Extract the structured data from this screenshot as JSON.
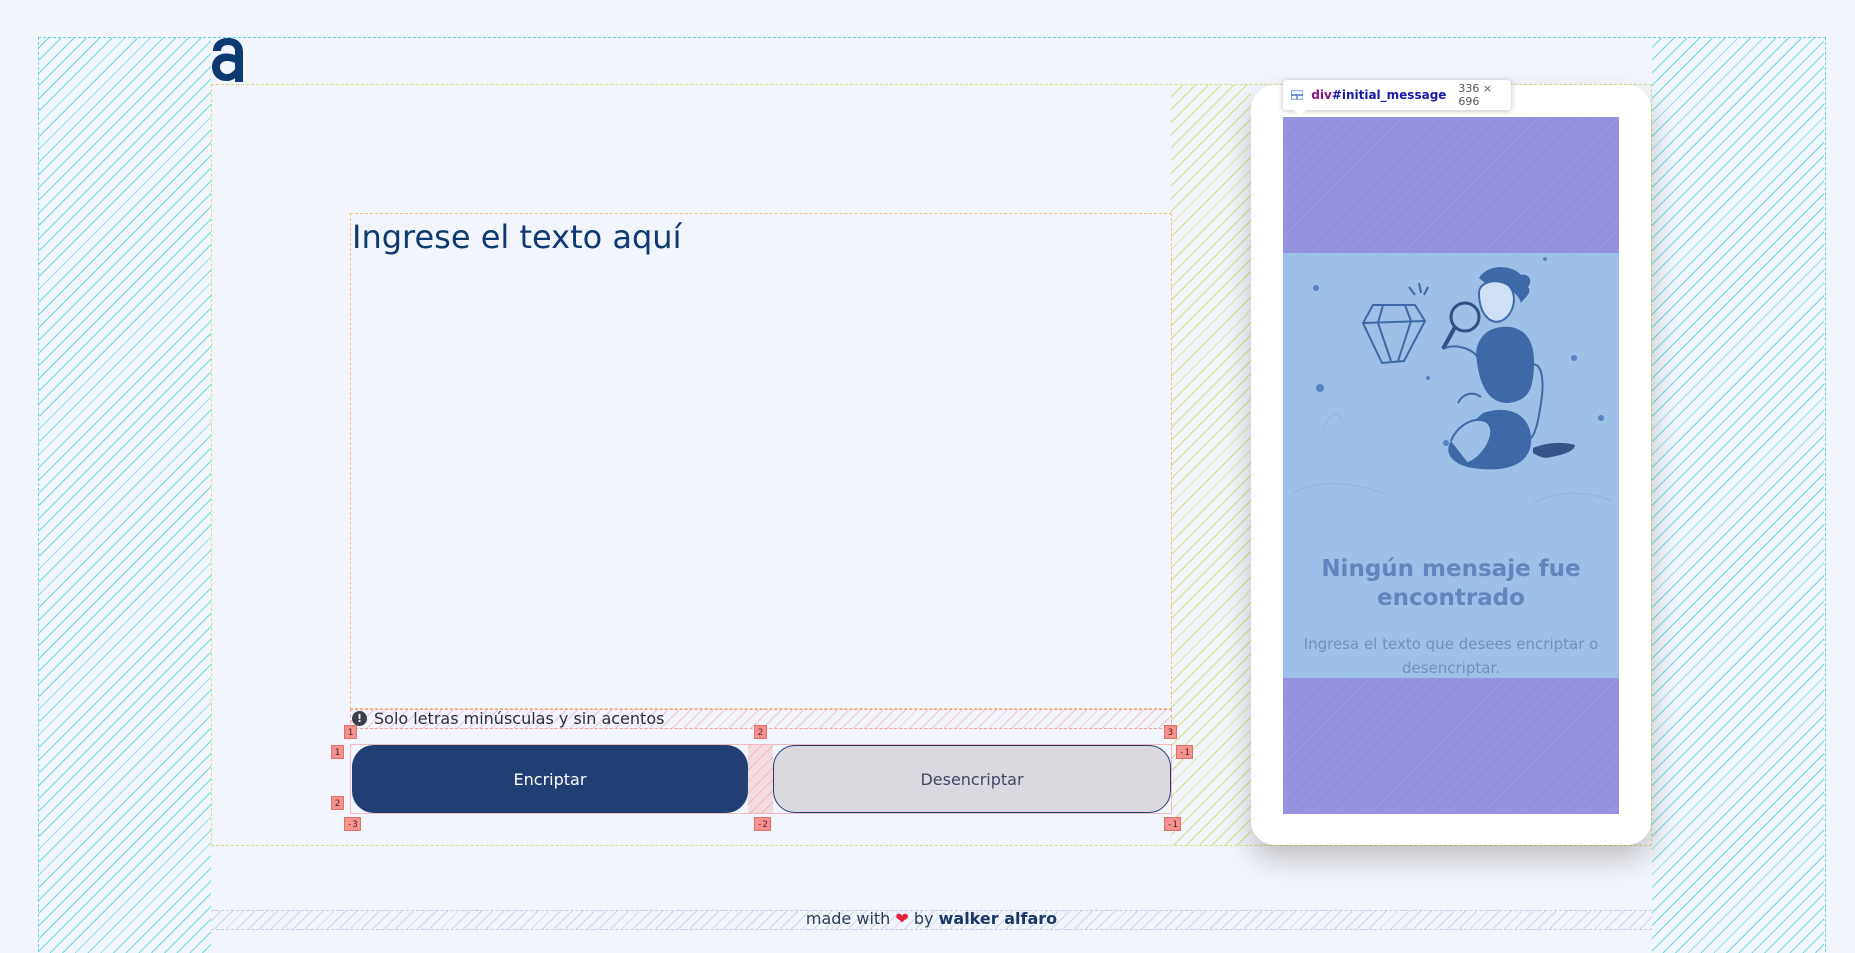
{
  "logo": {
    "letter": "a",
    "color": "#0e3a72"
  },
  "editor": {
    "placeholder": "Ingrese el texto aquí",
    "value": ""
  },
  "hint": {
    "icon": "exclamation-circle-icon",
    "text": "Solo letras minúsculas y sin acentos"
  },
  "buttons": {
    "encrypt_label": "Encriptar",
    "decrypt_label": "Desencriptar"
  },
  "output_panel": {
    "empty_title": "Ningún mensaje fue encontrado",
    "empty_subtitle": "Ingresa el texto que desees encriptar o desencriptar."
  },
  "devtools_tooltip": {
    "tag": "div",
    "id": "#initial_message",
    "size": "336 × 696"
  },
  "spacing_markers": {
    "hint_top": [
      "1",
      "2",
      "3"
    ],
    "buttons_left": [
      "1",
      "2"
    ],
    "buttons_right_top": "-1",
    "bottom": [
      "-3",
      "-2",
      "-1"
    ]
  },
  "footer": {
    "prefix": "made with",
    "heart": "❤",
    "by": "by",
    "author": "walker alfaro"
  },
  "colors": {
    "primary": "#213f75",
    "secondary": "#dcd8df",
    "background": "#f3f5fc",
    "accent_text": "#0e3a72"
  }
}
